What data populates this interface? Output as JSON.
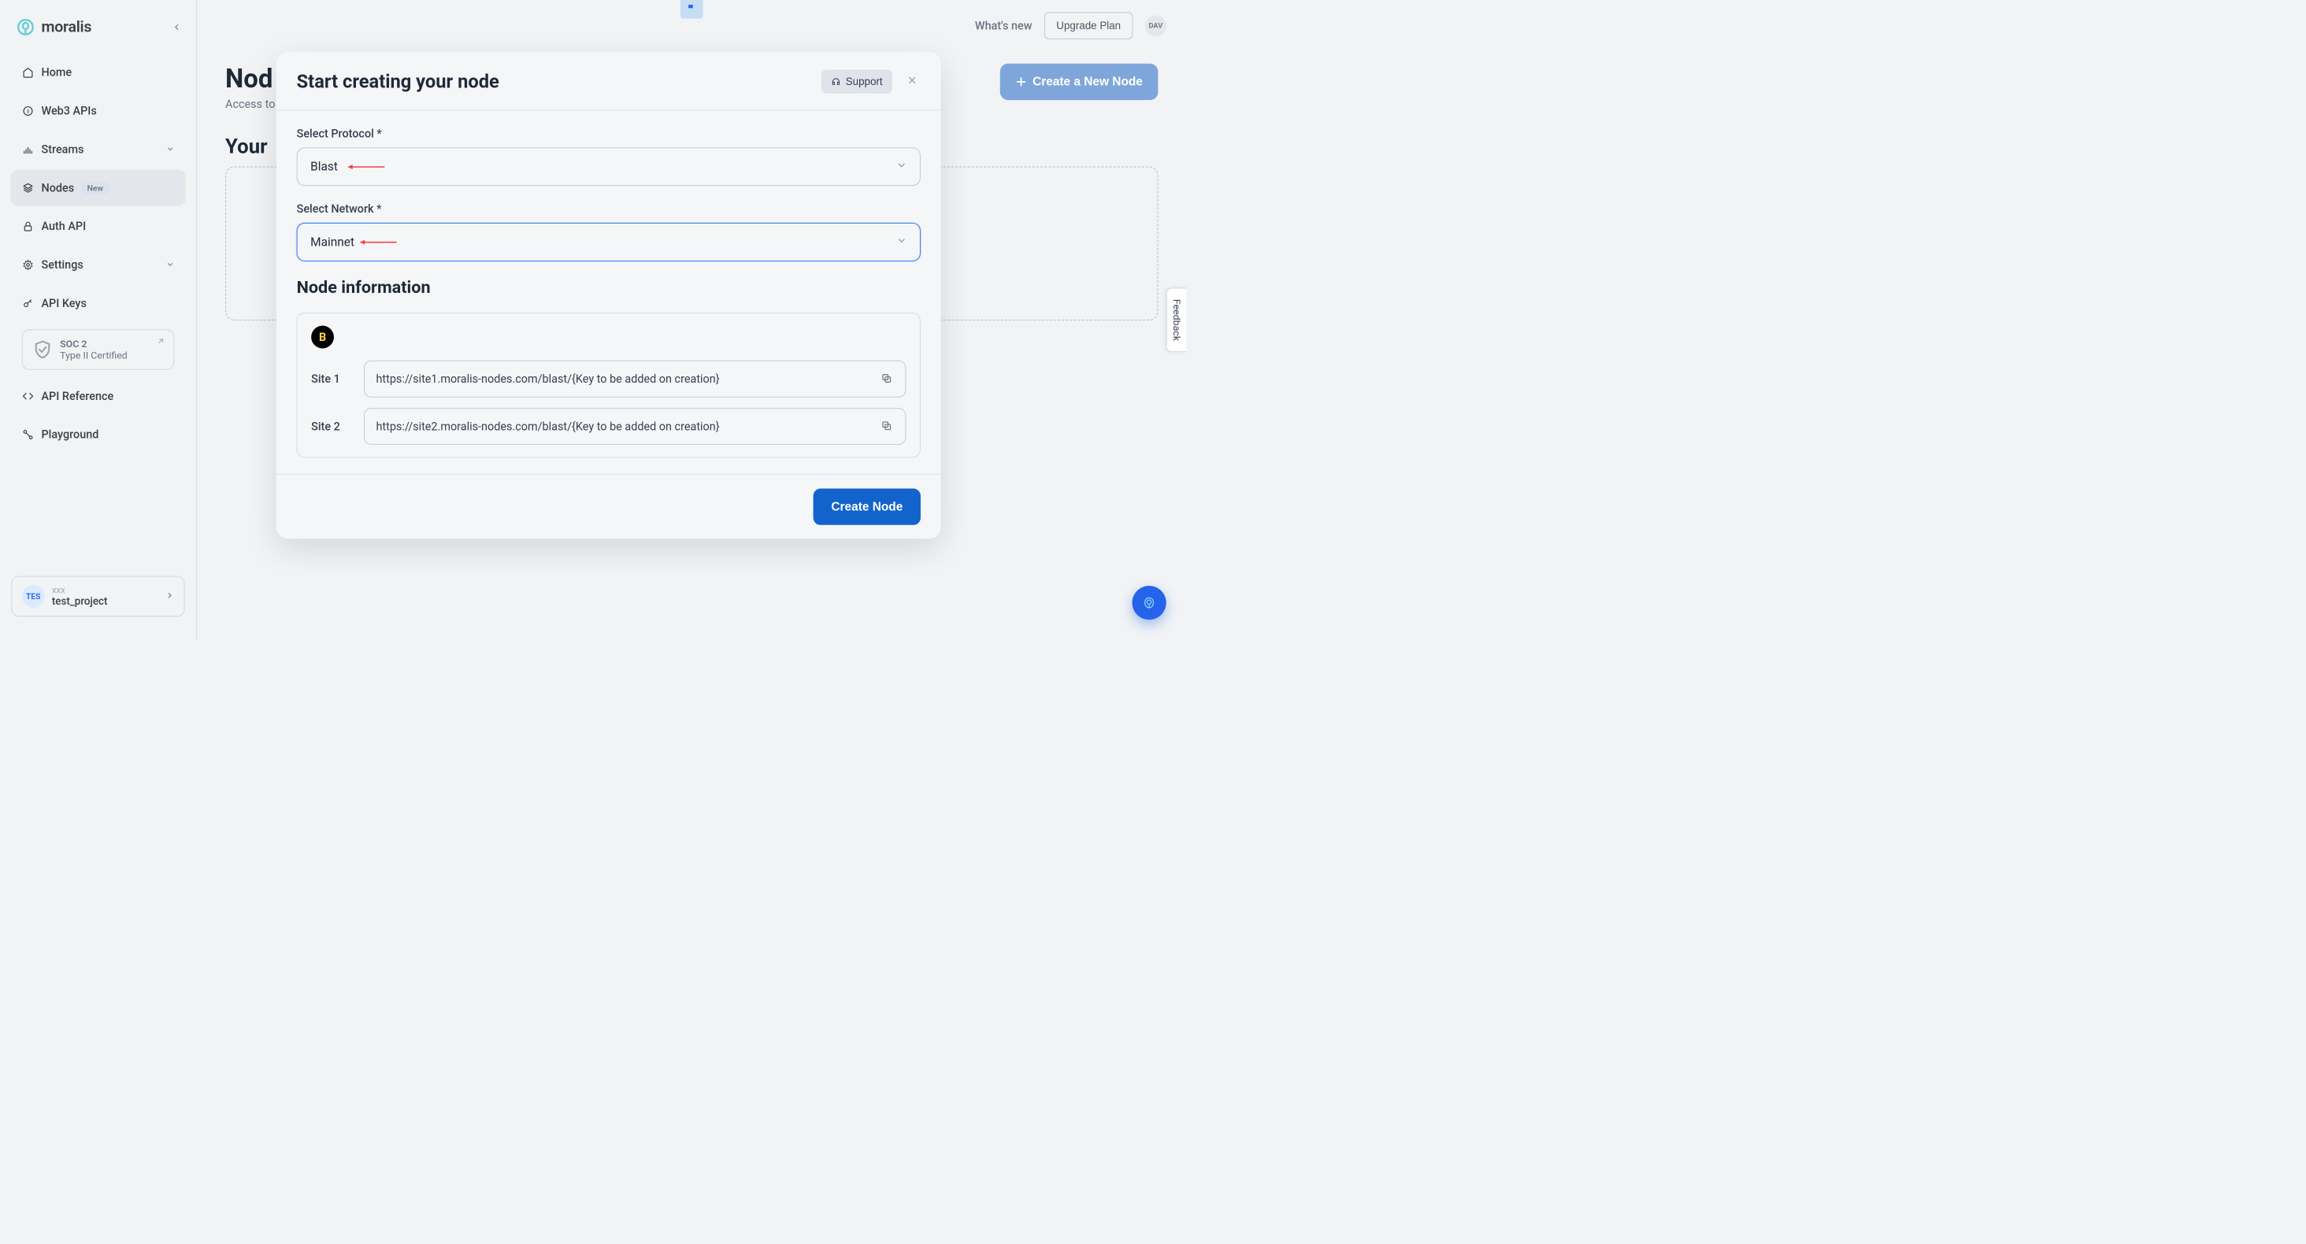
{
  "logo": {
    "text": "moralis"
  },
  "sidebar": {
    "items": [
      {
        "label": "Home"
      },
      {
        "label": "Web3 APIs"
      },
      {
        "label": "Streams"
      },
      {
        "label": "Nodes",
        "badge": "New"
      },
      {
        "label": "Auth API"
      },
      {
        "label": "Settings"
      },
      {
        "label": "API Keys"
      }
    ],
    "soc": {
      "title": "SOC 2",
      "sub": "Type II Certified"
    },
    "bottom": [
      {
        "label": "API Reference"
      },
      {
        "label": "Playground"
      }
    ],
    "project": {
      "label": "xxx",
      "name": "test_project",
      "avatar": "TES"
    }
  },
  "topbar": {
    "whats_new": "What's new",
    "upgrade": "Upgrade Plan",
    "avatar": "DAV"
  },
  "page": {
    "title": "Nod",
    "sub": "Access to",
    "create_btn": "Create a New Node",
    "section_title": "Your"
  },
  "modal": {
    "title": "Start creating your node",
    "support": "Support",
    "protocol_label": "Select Protocol *",
    "protocol_value": "Blast",
    "network_label": "Select Network *",
    "network_value": "Mainnet",
    "node_info_title": "Node information",
    "sites": [
      {
        "label": "Site 1",
        "url": "https://site1.moralis-nodes.com/blast/{Key to be added on creation}"
      },
      {
        "label": "Site 2",
        "url": "https://site2.moralis-nodes.com/blast/{Key to be added on creation}"
      }
    ],
    "create_btn": "Create Node"
  },
  "feedback": "Feedback"
}
